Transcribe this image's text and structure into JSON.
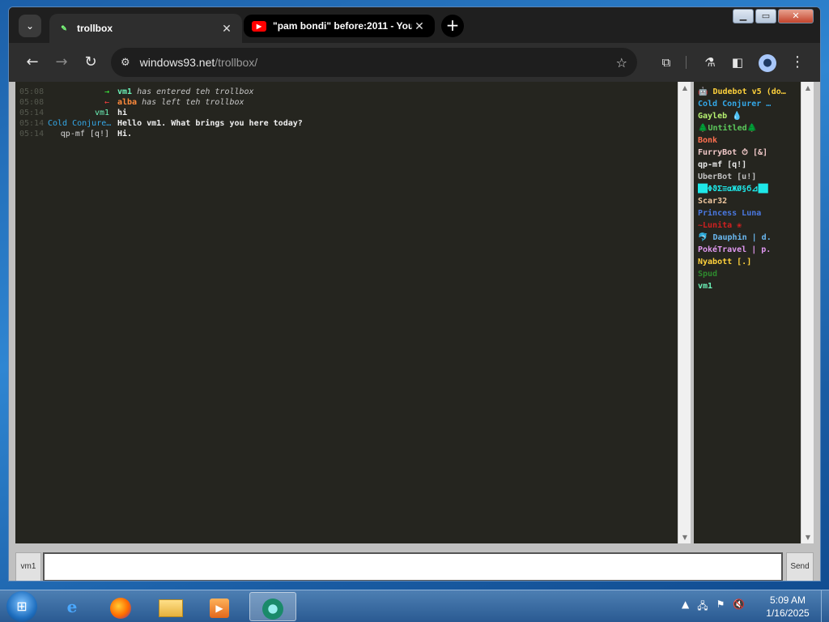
{
  "browser": {
    "tabs": [
      {
        "title": "trollbox",
        "favicon": "trollbox-favicon-icon",
        "active": true
      },
      {
        "title": "\"pam bondi\" before:2011 - You",
        "favicon": "youtube-favicon-icon",
        "active": false
      }
    ],
    "url_host": "windows93.net",
    "url_path": "/trollbox/"
  },
  "chat": {
    "messages": [
      {
        "time": "05:08",
        "nick": "→",
        "nick_color": "#3cff3c",
        "who": "vm1",
        "who_color": "#6cf2b8",
        "text": " has entered teh trollbox",
        "system": true
      },
      {
        "time": "05:08",
        "nick": "←",
        "nick_color": "#ff4040",
        "who": "alba",
        "who_color": "#ff8a3c",
        "text": " has left teh trollbox",
        "system": true
      },
      {
        "time": "05:14",
        "nick": "vm1",
        "nick_color": "#6cf2b8",
        "who": "",
        "who_color": "",
        "text": "hi",
        "system": false
      },
      {
        "time": "05:14",
        "nick": "Cold Conjure…",
        "nick_color": "#34a8e8",
        "who": "",
        "who_color": "",
        "text": "Hello vm1. What brings you here today?",
        "system": false
      },
      {
        "time": "05:14",
        "nick": "qp-mf [q!]",
        "nick_color": "#d8d8d8",
        "who": "",
        "who_color": "",
        "text": "Hi.",
        "system": false
      }
    ],
    "users": [
      {
        "name": "🤖 Dudebot v5 (do…",
        "color": "#ffd23c"
      },
      {
        "name": "Cold Conjurer …",
        "color": "#34a8e8"
      },
      {
        "name": "Gayleb 💧",
        "color": "#b6f070"
      },
      {
        "name": "🌲Untitled🌲",
        "color": "#5cc85c"
      },
      {
        "name": "Bonk",
        "color": "#ff7050"
      },
      {
        "name": "FurryBot ⏱ [&]",
        "color": "#f0c8c8"
      },
      {
        "name": "qp-mf [q!]",
        "color": "#e8e8e8"
      },
      {
        "name": "UberBot [u!]",
        "color": "#c0c0c0"
      },
      {
        "name": "██ΦϑΣ≡αЖØ§Ϭ⊿██",
        "color": "#1ee8e8"
      },
      {
        "name": "Scar32",
        "color": "#f0c8a0"
      },
      {
        "name": "Princess Luna",
        "color": "#4a78e0"
      },
      {
        "name": "~Lunita ❀",
        "color": "#d02020"
      },
      {
        "name": "🐬 Dauphin | d.",
        "color": "#6ab8f0"
      },
      {
        "name": "PokéTravel | p.",
        "color": "#e098f0"
      },
      {
        "name": "Nyabott [.]",
        "color": "#ffd23c"
      },
      {
        "name": "Spud",
        "color": "#2e8a2e"
      },
      {
        "name": "vm1",
        "color": "#6cf2b8"
      }
    ],
    "input": {
      "nick_label": "vm1",
      "value": "",
      "send_label": "Send"
    }
  },
  "taskbar": {
    "clock_time": "5:09 AM",
    "clock_date": "1/16/2025"
  }
}
